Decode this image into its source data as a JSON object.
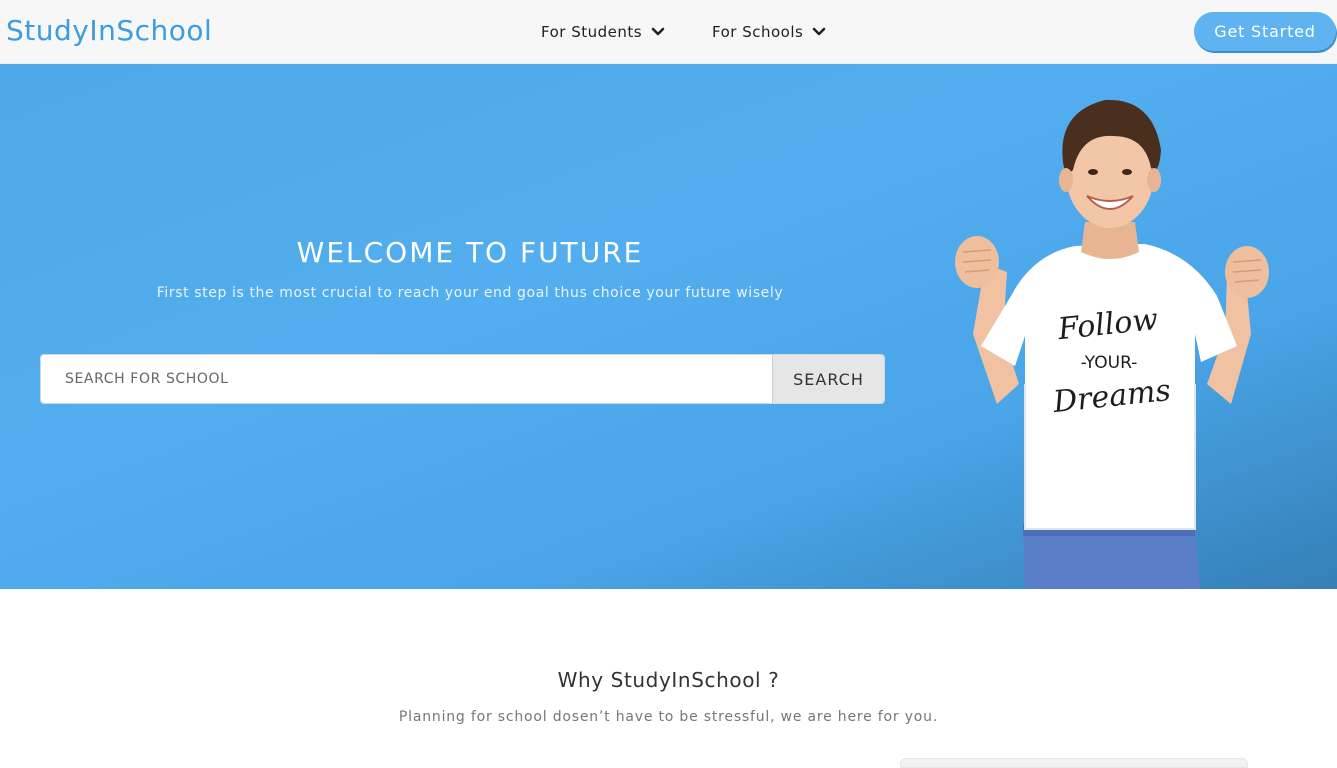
{
  "header": {
    "brand": "StudyInSchool",
    "nav": [
      {
        "label": "For Students",
        "icon": "chevron-down-icon"
      },
      {
        "label": "For Schools",
        "icon": "chevron-down-icon"
      }
    ],
    "cta_label": "Get Started"
  },
  "hero": {
    "title": "WELCOME TO FUTURE",
    "subtitle": "First step is the most crucial to reach your end goal thus choice your future wisely",
    "search": {
      "placeholder": "SEARCH FOR SCHOOL",
      "value": "",
      "button_label": "SEARCH"
    },
    "image": {
      "subject": "smiling boy with raised fists",
      "shirt_text": [
        "Follow",
        "-YOUR-",
        "Dreams"
      ]
    }
  },
  "why": {
    "title": "Why StudyInSchool ?",
    "subtitle": "Planning for school dosen’t have to be stressful, we are here for you."
  },
  "colors": {
    "brand": "#3d9ddf",
    "hero_bg": "#4fa8e8",
    "cta_bg": "#5fb3f0",
    "header_bg": "#f7f7f7"
  }
}
